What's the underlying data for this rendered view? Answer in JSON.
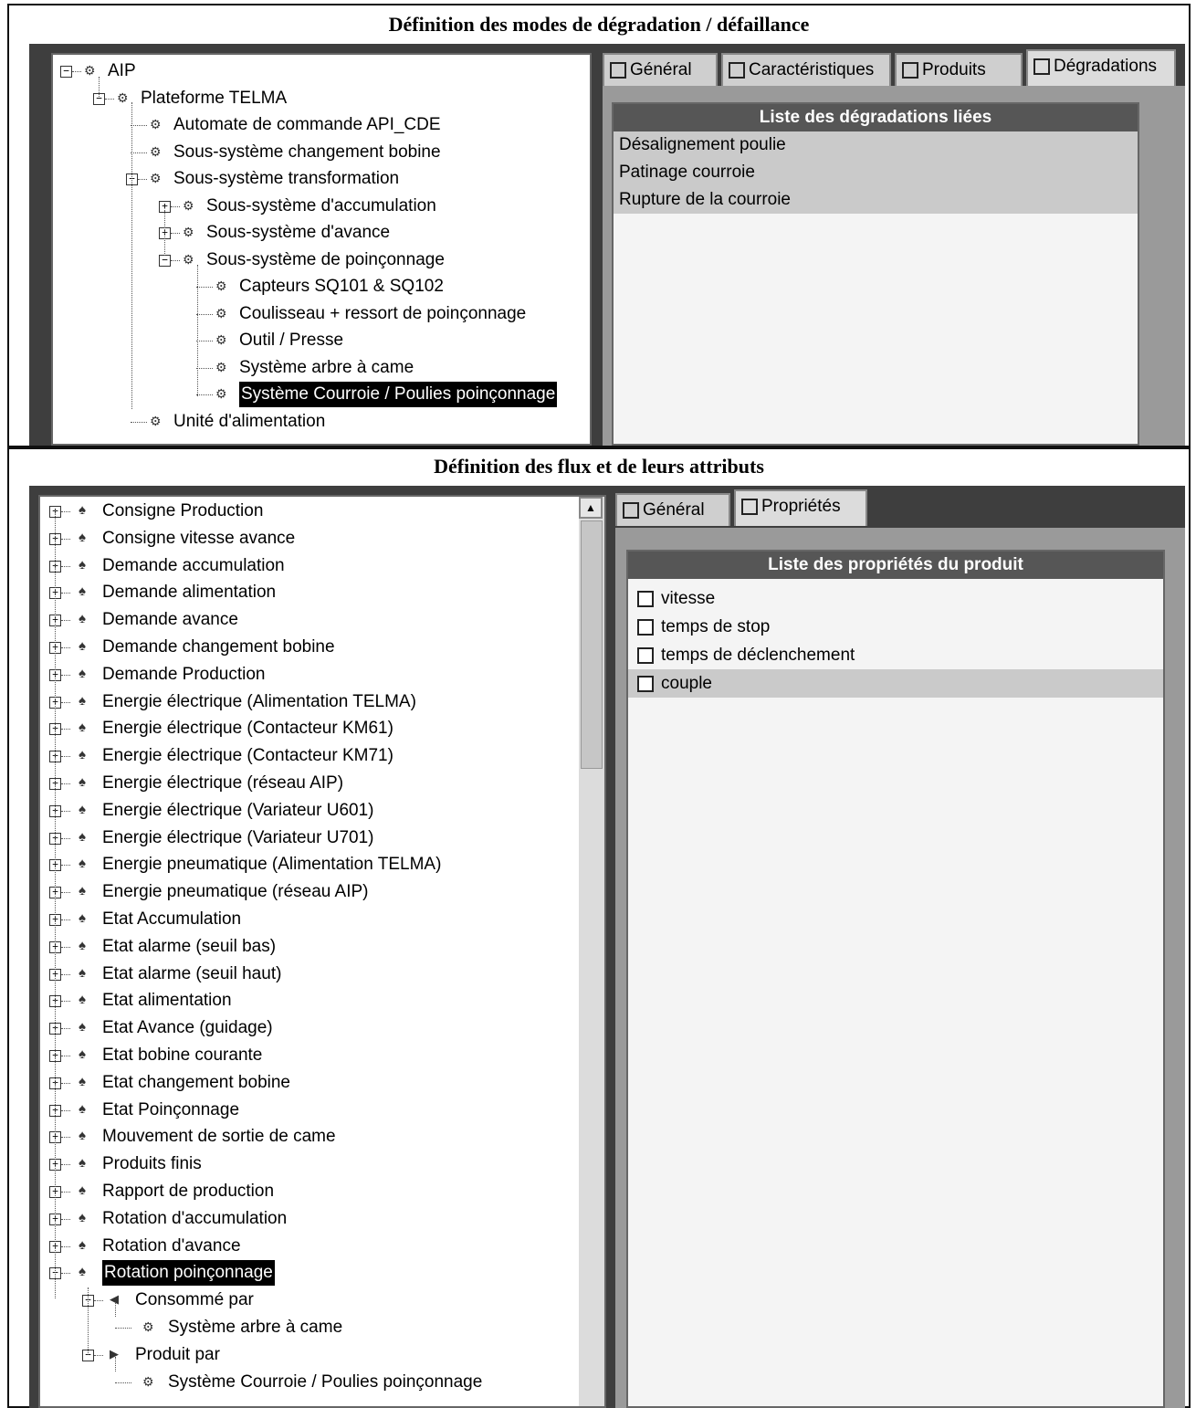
{
  "top": {
    "title": "Définition des modes de dégradation / défaillance",
    "tree": [
      {
        "label": "AIP",
        "level": 0,
        "expander": "minus"
      },
      {
        "label": "Plateforme TELMA",
        "level": 1,
        "expander": "minus"
      },
      {
        "label": "Automate de commande API_CDE",
        "level": 2,
        "expander": null
      },
      {
        "label": "Sous-système changement bobine",
        "level": 2,
        "expander": null
      },
      {
        "label": "Sous-système transformation",
        "level": 2,
        "expander": "minus"
      },
      {
        "label": "Sous-système d'accumulation",
        "level": 3,
        "expander": "plus"
      },
      {
        "label": "Sous-système d'avance",
        "level": 3,
        "expander": "plus"
      },
      {
        "label": "Sous-système de poinçonnage",
        "level": 3,
        "expander": "minus"
      },
      {
        "label": "Capteurs SQ101 & SQ102",
        "level": 4,
        "expander": null
      },
      {
        "label": "Coulisseau + ressort de poinçonnage",
        "level": 4,
        "expander": null
      },
      {
        "label": "Outil / Presse",
        "level": 4,
        "expander": null
      },
      {
        "label": "Système arbre à came",
        "level": 4,
        "expander": null
      },
      {
        "label": "Système Courroie / Poulies poinçonnage",
        "level": 4,
        "expander": null,
        "selected": true
      },
      {
        "label": "Unité d'alimentation",
        "level": 2,
        "expander": null
      }
    ],
    "tabs": [
      {
        "label": "Général",
        "icon": "cube-icon"
      },
      {
        "label": "Caractéristiques",
        "icon": "characteristics-icon"
      },
      {
        "label": "Produits",
        "icon": "products-icon"
      },
      {
        "label": "Dégradations",
        "icon": "degradations-icon",
        "active": true
      }
    ],
    "list_header": "Liste des dégradations liées",
    "list_items": [
      "Désalignement poulie",
      "Patinage courroie",
      "Rupture de la courroie"
    ]
  },
  "bottom": {
    "title": "Définition des flux et de leurs attributs",
    "flows": [
      "Consigne Production",
      "Consigne vitesse avance",
      "Demande accumulation",
      "Demande alimentation",
      "Demande avance",
      "Demande changement bobine",
      "Demande Production",
      "Energie électrique (Alimentation TELMA)",
      "Energie électrique (Contacteur KM61)",
      "Energie électrique (Contacteur KM71)",
      "Energie électrique (réseau AIP)",
      "Energie électrique (Variateur U601)",
      "Energie électrique (Variateur U701)",
      "Energie pneumatique (Alimentation TELMA)",
      "Energie pneumatique (réseau AIP)",
      "Etat Accumulation",
      "Etat alarme (seuil bas)",
      "Etat alarme (seuil haut)",
      "Etat alimentation",
      "Etat Avance (guidage)",
      "Etat bobine courante",
      "Etat changement bobine",
      "Etat Poinçonnage",
      "Mouvement de sortie de came",
      "Produits finis",
      "Rapport de production",
      "Rotation d'accumulation",
      "Rotation d'avance",
      "Rotation poinçonnage"
    ],
    "selected_flow": "Rotation poinçonnage",
    "children": [
      {
        "label": "Consommé par",
        "icon": "consumed-arrow-icon",
        "child": "Système arbre à came"
      },
      {
        "label": "Produit par",
        "icon": "produced-arrow-icon",
        "child": "Système Courroie / Poulies poinçonnage"
      }
    ],
    "tabs": [
      {
        "label": "Général",
        "icon": "cube-icon"
      },
      {
        "label": "Propriétés",
        "icon": "properties-icon",
        "active": true
      }
    ],
    "list_header": "Liste des propriétés du produit",
    "properties": [
      {
        "label": "vitesse",
        "checked": false
      },
      {
        "label": "temps de stop",
        "checked": false
      },
      {
        "label": "temps de déclenchement",
        "checked": false
      },
      {
        "label": "couple",
        "checked": false,
        "highlighted": true
      }
    ],
    "scroll_up_glyph": "▲"
  }
}
